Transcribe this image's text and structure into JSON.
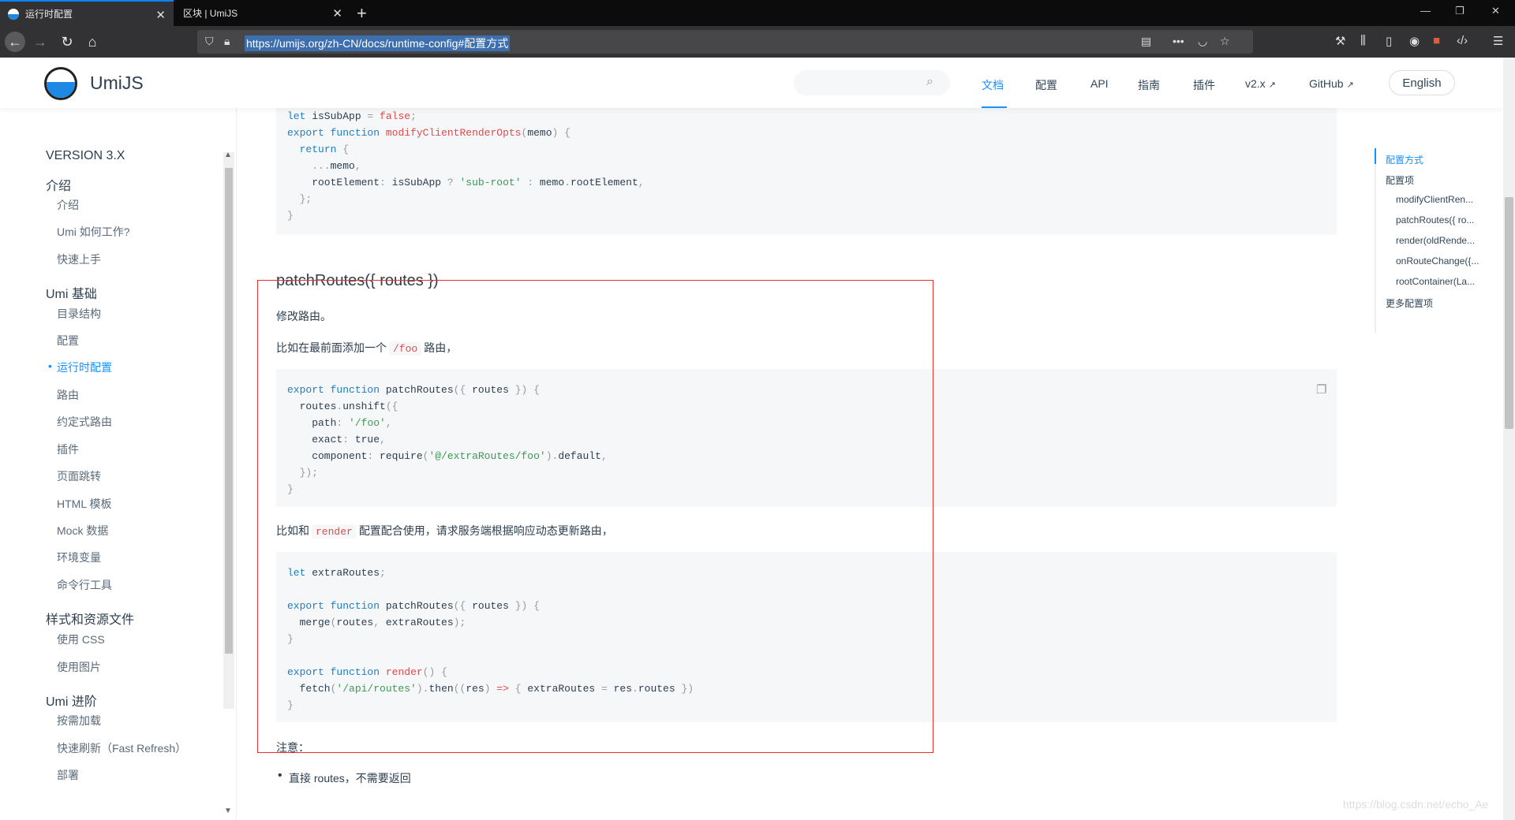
{
  "browser": {
    "tabs": [
      {
        "title": "运行时配置"
      },
      {
        "title": "区块 | UmiJS"
      }
    ],
    "url": "https://umijs.org/zh-CN/docs/runtime-config#配置方式"
  },
  "header": {
    "brand": "UmiJS",
    "nav": [
      "文档",
      "配置",
      "API",
      "指南",
      "插件",
      "v2.x",
      "GitHub"
    ],
    "lang_button": "English"
  },
  "sidebar": {
    "version": "VERSION 3.X",
    "groups": [
      {
        "title": "介绍",
        "items": [
          "介绍",
          "Umi 如何工作?",
          "快速上手"
        ]
      },
      {
        "title": "Umi 基础",
        "items": [
          "目录结构",
          "配置",
          "运行时配置",
          "路由",
          "约定式路由",
          "插件",
          "页面跳转",
          "HTML 模板",
          "Mock 数据",
          "环境变量",
          "命令行工具"
        ]
      },
      {
        "title": "样式和资源文件",
        "items": [
          "使用 CSS",
          "使用图片"
        ]
      },
      {
        "title": "Umi 进阶",
        "items": [
          "按需加载",
          "快速刷新（Fast Refresh）",
          "部署"
        ]
      }
    ]
  },
  "content": {
    "heading": "patchRoutes({ routes })",
    "p1": "修改路由。",
    "p2_pre": "比如在最前面添加一个",
    "p2_code": "/foo",
    "p2_post": "路由，",
    "p3_pre": "比如和",
    "p3_code": "render",
    "p3_post": "配置配合使用，请求服务端根据响应动态更新路由，",
    "p4": "注意：",
    "bullet": "直接 routes，不需要返回"
  },
  "toc": {
    "items": [
      "配置方式",
      "配置项",
      "modifyClientRen...",
      "patchRoutes({ ro...",
      "render(oldRende...",
      "onRouteChange({...",
      "rootContainer(La...",
      "更多配置项"
    ]
  },
  "watermark": "https://blog.csdn.net/echo_Ae"
}
